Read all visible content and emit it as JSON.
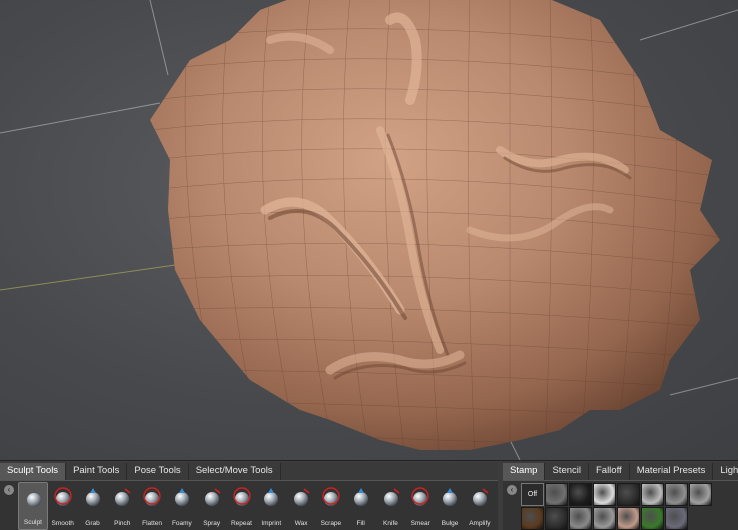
{
  "left_tabs": [
    {
      "label": "Sculpt Tools",
      "active": true
    },
    {
      "label": "Paint Tools",
      "active": false
    },
    {
      "label": "Pose Tools",
      "active": false
    },
    {
      "label": "Select/Move Tools",
      "active": false
    }
  ],
  "right_tabs": [
    {
      "label": "Stamp",
      "active": true
    },
    {
      "label": "Stencil",
      "active": false
    },
    {
      "label": "Falloff",
      "active": false
    },
    {
      "label": "Material Presets",
      "active": false
    },
    {
      "label": "Lighting",
      "active": false
    }
  ],
  "tools": [
    {
      "label": "Sculpt",
      "icon": "sculpt-icon",
      "active": true
    },
    {
      "label": "Smooth",
      "icon": "smooth-icon"
    },
    {
      "label": "Grab",
      "icon": "grab-icon"
    },
    {
      "label": "Pinch",
      "icon": "pinch-icon"
    },
    {
      "label": "Flatten",
      "icon": "flatten-icon"
    },
    {
      "label": "Foamy",
      "icon": "foamy-icon"
    },
    {
      "label": "Spray",
      "icon": "spray-icon"
    },
    {
      "label": "Repeat",
      "icon": "repeat-icon"
    },
    {
      "label": "Imprint",
      "icon": "imprint-icon"
    },
    {
      "label": "Wax",
      "icon": "wax-icon"
    },
    {
      "label": "Scrape",
      "icon": "scrape-icon"
    },
    {
      "label": "Fill",
      "icon": "fill-icon"
    },
    {
      "label": "Knife",
      "icon": "knife-icon"
    },
    {
      "label": "Smear",
      "icon": "smear-icon"
    },
    {
      "label": "Bulge",
      "icon": "bulge-icon"
    },
    {
      "label": "Amplify",
      "icon": "amplify-icon"
    }
  ],
  "stamps": {
    "off_label": "Off",
    "colors": [
      "#3c3c3c",
      "#707070",
      "#1c1c1c",
      "#dcdcdc",
      "#2c2c2c",
      "#bcbcbc",
      "#909090",
      "#a0a0a0",
      "#7a4a1c",
      "#5a3a1e",
      "#2c2c2c",
      "#8a8a8a",
      "#9a9a9a",
      "#c09a8a",
      "#3a7a2a",
      "#6a6a7a"
    ]
  },
  "colors": {
    "clay": "#b0826a",
    "shelf_bg": "#3c3c3c",
    "active_tab": "#575757",
    "tool_accent": "#cc2222"
  }
}
